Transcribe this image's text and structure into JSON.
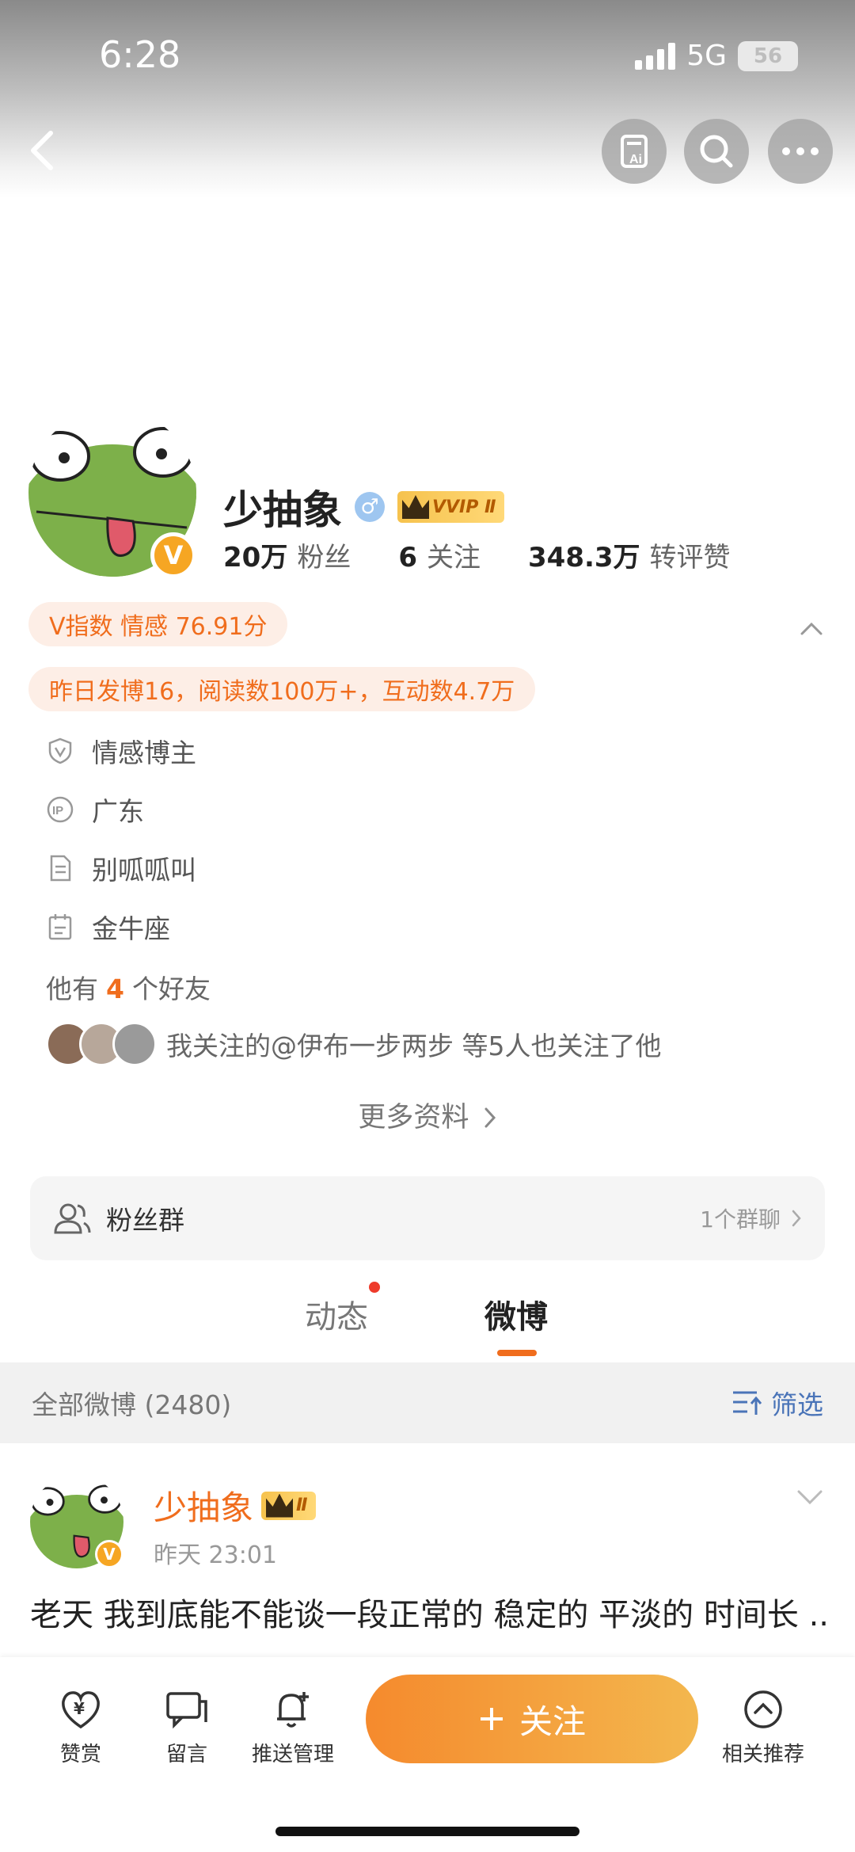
{
  "status_bar": {
    "time": "6:28",
    "network": "5G",
    "battery": "56"
  },
  "header": {
    "buttons": [
      "back",
      "ai",
      "search",
      "more"
    ]
  },
  "profile": {
    "name": "少抽象",
    "vvip_label": "VVIP Ⅱ",
    "followers_count": "20万",
    "followers_label": "粉丝",
    "following_count": "6",
    "following_label": "关注",
    "interactions_count": "348.3万",
    "interactions_label": "转评赞"
  },
  "pills": {
    "v_index": "V指数 情感 76.91分",
    "yesterday": "昨日发博16，阅读数100万+，互动数4.7万"
  },
  "info_rows": [
    {
      "icon": "shield-v-icon",
      "text": "情感博主"
    },
    {
      "icon": "ip-icon",
      "text": "广东"
    },
    {
      "icon": "document-icon",
      "text": "别呱呱叫"
    },
    {
      "icon": "calendar-icon",
      "text": "金牛座"
    }
  ],
  "friends": {
    "prefix": "他有",
    "count": "4",
    "suffix": "个好友"
  },
  "mutual_follow": "我关注的@伊布一步两步 等5人也关注了他",
  "more_info": "更多资料",
  "fan_group": {
    "label": "粉丝群",
    "right": "1个群聊"
  },
  "tabs": [
    {
      "label": "动态"
    },
    {
      "label": "微博"
    }
  ],
  "filter": {
    "count_text": "全部微博 (2480)",
    "filter_label": "筛选"
  },
  "post": {
    "author": "少抽象",
    "badge": "Ⅱ",
    "time": "昨天 23:01",
    "text": "老天 我到底能不能谈一段正常的 稳定的 平淡的 时间长 ..."
  },
  "bottom_bar": {
    "reward": "赞赏",
    "message": "留言",
    "push": "推送管理",
    "follow": "关注",
    "related": "相关推荐"
  },
  "colors": {
    "accent": "#f06d1d",
    "link": "#4a74b8"
  }
}
